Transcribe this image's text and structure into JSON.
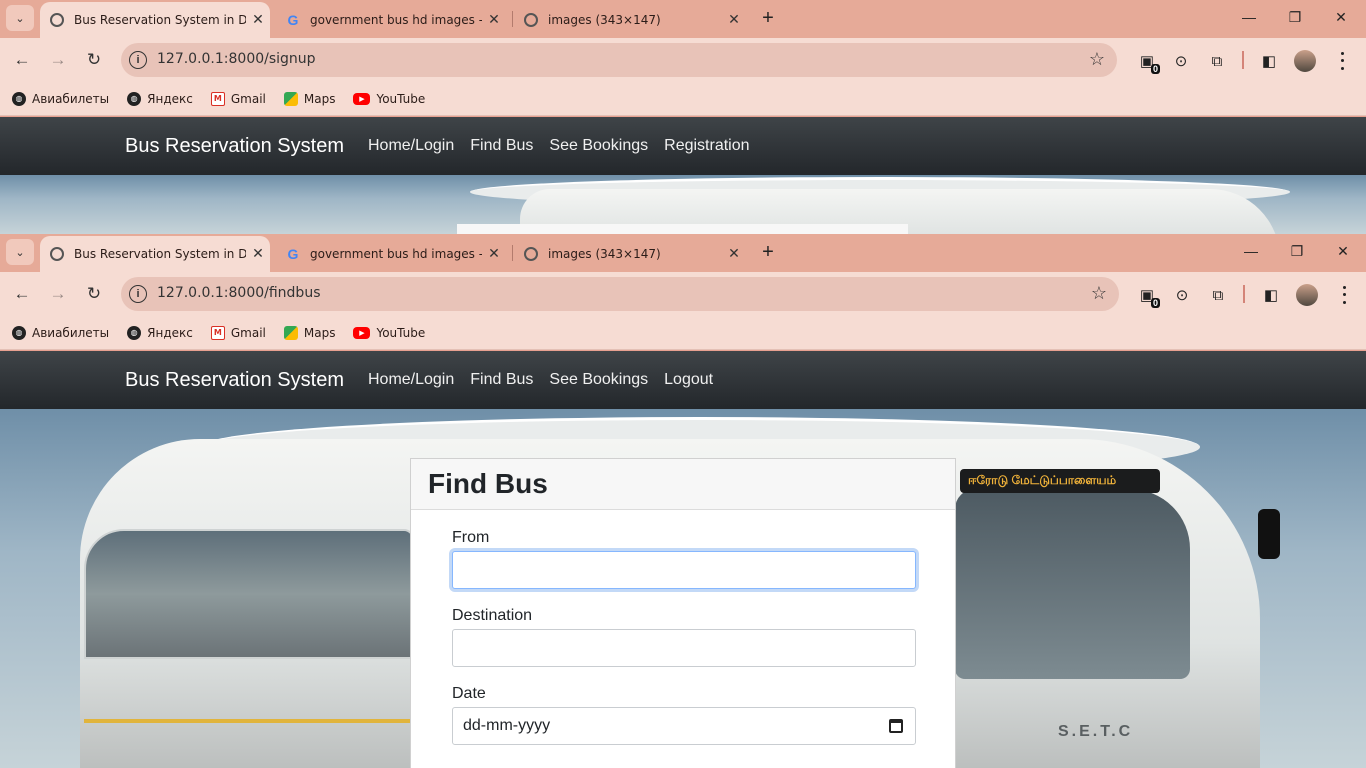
{
  "browser": {
    "tabs": [
      {
        "title": "Bus Reservation System in Djan",
        "active": true
      },
      {
        "title": "government bus hd images - G",
        "active": false
      },
      {
        "title": "images (343×147)",
        "active": false
      }
    ],
    "new_tab": "+",
    "window_controls": {
      "minimize": "—",
      "restore": "❐",
      "close": "✕"
    },
    "bookmarks": [
      {
        "label": "Авиабилеты",
        "icon": "globe-icon"
      },
      {
        "label": "Яндекс",
        "icon": "globe-icon"
      },
      {
        "label": "Gmail",
        "icon": "gmail-icon"
      },
      {
        "label": "Maps",
        "icon": "maps-icon"
      },
      {
        "label": "YouTube",
        "icon": "youtube-icon"
      }
    ],
    "extensions_badge": "0"
  },
  "window_back": {
    "url": "127.0.0.1:8000/signup",
    "nav": {
      "brand": "Bus Reservation System",
      "links": [
        "Home/Login",
        "Find Bus",
        "See Bookings",
        "Registration"
      ]
    }
  },
  "window_front": {
    "url": "127.0.0.1:8000/findbus",
    "nav": {
      "brand": "Bus Reservation System",
      "links": [
        "Home/Login",
        "Find Bus",
        "See Bookings",
        "Logout"
      ]
    },
    "form": {
      "title": "Find Bus",
      "from_label": "From",
      "from_value": "",
      "destination_label": "Destination",
      "destination_value": "",
      "date_label": "Date",
      "date_placeholder": "dd-mm-yyyy"
    },
    "bus_sign": "ஈரோடு மேட்டுப்பாளையம்",
    "bus_plate": "S.E.T.C"
  },
  "colors": {
    "tabstrip": "#e6aa98",
    "toolbar": "#f6dcd3",
    "navbar": "#2b3035",
    "focus_ring": "#86b7fe"
  }
}
